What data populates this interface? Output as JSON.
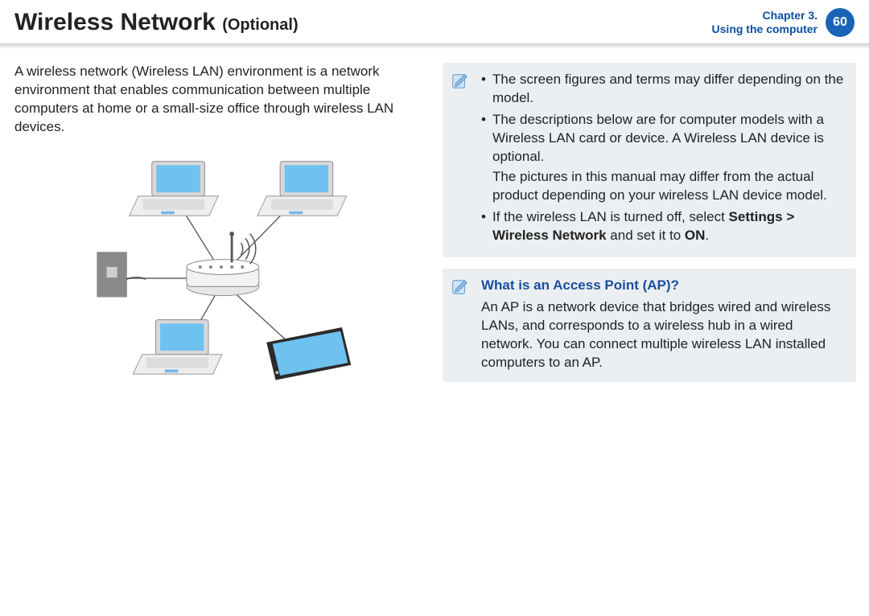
{
  "header": {
    "title": "Wireless Network",
    "tag": "(Optional)",
    "chapter_line1": "Chapter 3.",
    "chapter_line2": "Using the computer",
    "page": "60"
  },
  "intro": "A wireless network (Wireless LAN) environment is a network environment that enables communication between multiple computers at home or a small-size office through wireless LAN devices.",
  "notes": {
    "item1": "The screen figures and terms may differ depending on the model.",
    "item2a": "The descriptions below are for computer models with a Wireless LAN card or device. A Wireless LAN device is optional.",
    "item2b": "The pictures in this manual may differ from the actual product depending on your wireless LAN device model.",
    "item3_pre": "If the wireless LAN is turned off, select ",
    "item3_bold1": "Settings > Wireless Network",
    "item3_mid": " and set it to ",
    "item3_bold2": "ON",
    "item3_post": "."
  },
  "ap": {
    "title": "What is an Access Point (AP)?",
    "body": "An AP is a network device that bridges wired and wireless LANs, and corresponds to a wireless hub in a wired network. You can connect multiple wireless LAN installed computers to an AP."
  },
  "icons": {
    "note": "note-icon"
  },
  "diagram": {
    "devices": [
      "laptop",
      "laptop",
      "laptop",
      "tablet"
    ],
    "hub": "access-point",
    "uplink": "wall-jack"
  }
}
